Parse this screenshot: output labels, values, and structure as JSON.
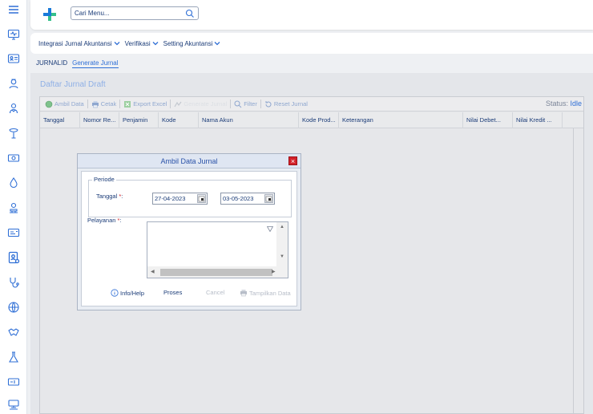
{
  "app": {
    "search_placeholder": "Cari Menu..."
  },
  "menu": [
    {
      "label": "Integrasi Jurnal Akuntansi"
    },
    {
      "label": "Verifikasi"
    },
    {
      "label": "Setting Akuntansi"
    }
  ],
  "tabs": [
    {
      "label": "JURNALID"
    },
    {
      "label": "Generate Jurnal"
    }
  ],
  "panel": {
    "title": "Daftar Jurnal Draft",
    "toolbar": {
      "ambil_data": "Ambil Data",
      "cetak": "Cetak",
      "export_excel": "Export Excel",
      "disabled_btn": "Generate Jurnal",
      "filter": "Filter",
      "reset_jurnal": "Reset Jurnal"
    },
    "status_label": "Status:",
    "status_value": "Idle",
    "columns": [
      "Tanggal",
      "Nomor Re...",
      "Penjamin",
      "Kode",
      "Nama Akun",
      "Kode Prod...",
      "Keterangan",
      "Nilai Debet...",
      "Nilai Kredit ..."
    ]
  },
  "modal": {
    "title": "Ambil Data Jurnal",
    "close": "×",
    "periode_legend": "Periode",
    "tanggal_label": "Tanggal",
    "required_mark": "*",
    "colon": ":",
    "date_from": "27-04-2023",
    "date_to": "03-05-2023",
    "pelayanan_label": "Pelayanan",
    "buttons": {
      "info_help": "Info/Help",
      "proses": "Proses",
      "cancel": "Cancel",
      "tampilkan_data": "Tampilkan Data"
    }
  },
  "colors": {
    "accent": "#2f6fd6",
    "close_red": "#d3222a",
    "text_dark": "#1b3c78"
  },
  "sidebar_icons": [
    "menu-icon",
    "monitor-icon",
    "id-card-icon",
    "nurse-icon",
    "doctor-icon",
    "medicine-icon",
    "money-icon",
    "drop-icon",
    "lab-icon",
    "card-icon",
    "user-card-icon",
    "stethoscope-icon",
    "globe-icon",
    "handshake-icon",
    "flask-icon",
    "bed-icon",
    "workstation-icon"
  ]
}
